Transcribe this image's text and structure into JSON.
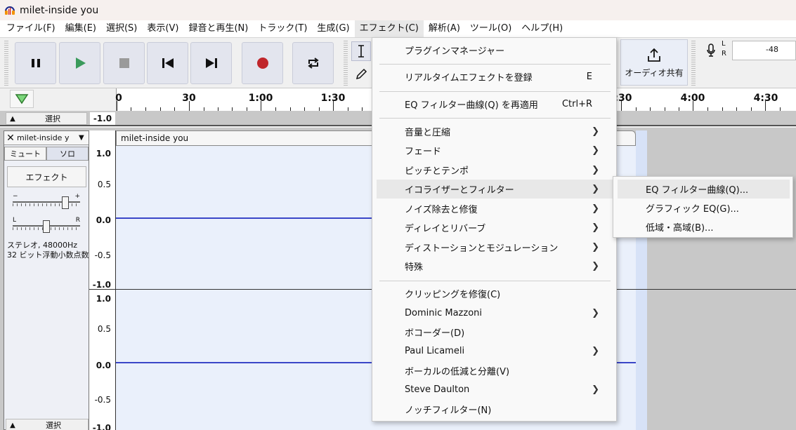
{
  "window": {
    "title": "milet-inside you"
  },
  "menubar": [
    "ファイル(F)",
    "編集(E)",
    "選択(S)",
    "表示(V)",
    "録音と再生(N)",
    "トラック(T)",
    "生成(G)",
    "エフェクト(C)",
    "解析(A)",
    "ツール(O)",
    "ヘルプ(H)"
  ],
  "toolbar": {
    "share_label": "オーディオ共有",
    "meter": {
      "l": "L",
      "r": "R",
      "db": "-48"
    }
  },
  "ruler": {
    "ticks": [
      "0",
      "30",
      "1:00",
      "1:30",
      ":30",
      "4:00",
      "4:30"
    ]
  },
  "selbar": {
    "label": "選択",
    "value": "-1.0"
  },
  "track": {
    "name": "milet-inside y",
    "mute": "ミュート",
    "solo": "ソロ",
    "effects": "エフェクト",
    "gain_minus": "−",
    "gain_plus": "+",
    "pan_l": "L",
    "pan_r": "R",
    "info_line1": "ステレオ, 48000Hz",
    "info_line2": "32 ビット浮動小数点数",
    "bottom_label": "選択",
    "clip_name": "milet-inside you"
  },
  "vruler": {
    "ch1": [
      "1.0",
      "0.5",
      "0.0",
      "-0.5",
      "-1.0"
    ],
    "ch2": [
      "1.0",
      "0.5",
      "0.0",
      "-0.5",
      "-1.0"
    ]
  },
  "dropdown": {
    "items": [
      {
        "label": "プラグインマネージャー"
      },
      {
        "label": "リアルタイムエフェクトを登録",
        "shortcut": "E"
      },
      {
        "label": "EQ フィルター曲線(Q) を再適用",
        "shortcut": "Ctrl+R"
      },
      {
        "label": "音量と圧縮",
        "submenu": true
      },
      {
        "label": "フェード",
        "submenu": true
      },
      {
        "label": "ピッチとテンポ",
        "submenu": true
      },
      {
        "label": "イコライザーとフィルター",
        "submenu": true
      },
      {
        "label": "ノイズ除去と修復",
        "submenu": true
      },
      {
        "label": "ディレイとリバーブ",
        "submenu": true
      },
      {
        "label": "ディストーションとモジュレーション",
        "submenu": true
      },
      {
        "label": "特殊",
        "submenu": true
      },
      {
        "label": "クリッピングを修復(C)"
      },
      {
        "label": "Dominic Mazzoni",
        "submenu": true
      },
      {
        "label": "ボコーダー(D)"
      },
      {
        "label": "Paul Licameli",
        "submenu": true
      },
      {
        "label": "ボーカルの低減と分離(V)"
      },
      {
        "label": "Steve Daulton",
        "submenu": true
      },
      {
        "label": "ノッチフィルター(N)"
      }
    ]
  },
  "submenu": {
    "items": [
      "EQ フィルター曲線(Q)...",
      "グラフィック EQ(G)...",
      "低域・高域(B)..."
    ]
  },
  "colors": {
    "accent": "#3a46c8",
    "record": "#c0262b",
    "play": "#3a9a5b"
  }
}
